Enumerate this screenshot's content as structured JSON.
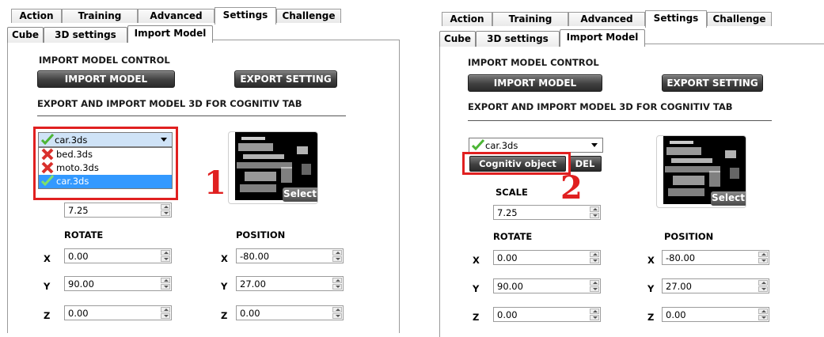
{
  "tabs": [
    "Action",
    "Training",
    "Advanced",
    "Settings",
    "Challenge"
  ],
  "subtabs": [
    "Cube",
    "3D settings",
    "Import Model"
  ],
  "import_control_title": "IMPORT MODEL CONTROL",
  "import_button": "IMPORT MODEL",
  "export_button": "EXPORT SETTING",
  "cognitiv_title": "EXPORT AND IMPORT MODEL 3D FOR COGNITIV TAB",
  "model_selected": "car.3ds",
  "model_list": [
    "bed.3ds",
    "moto.3ds",
    "car.3ds"
  ],
  "preview_select": "Select",
  "scale_label": "SCALE",
  "scale_value": "7.25",
  "rotate_label": "ROTATE",
  "position_label": "POSITION",
  "axes": [
    "X",
    "Y",
    "Z"
  ],
  "rotate_values": [
    "0.00",
    "90.00",
    "0.00"
  ],
  "position_values": [
    "-80.00",
    "27.00",
    "0.00"
  ],
  "cognitiv_object_button": "Cognitiv object",
  "del_button": "DEL",
  "annotation_1": "1",
  "annotation_2": "2",
  "colors": {
    "highlight_red": "#e02020",
    "selection_blue": "#3399ff",
    "check_green": "#4cb535",
    "cross_red": "#d9302c"
  }
}
